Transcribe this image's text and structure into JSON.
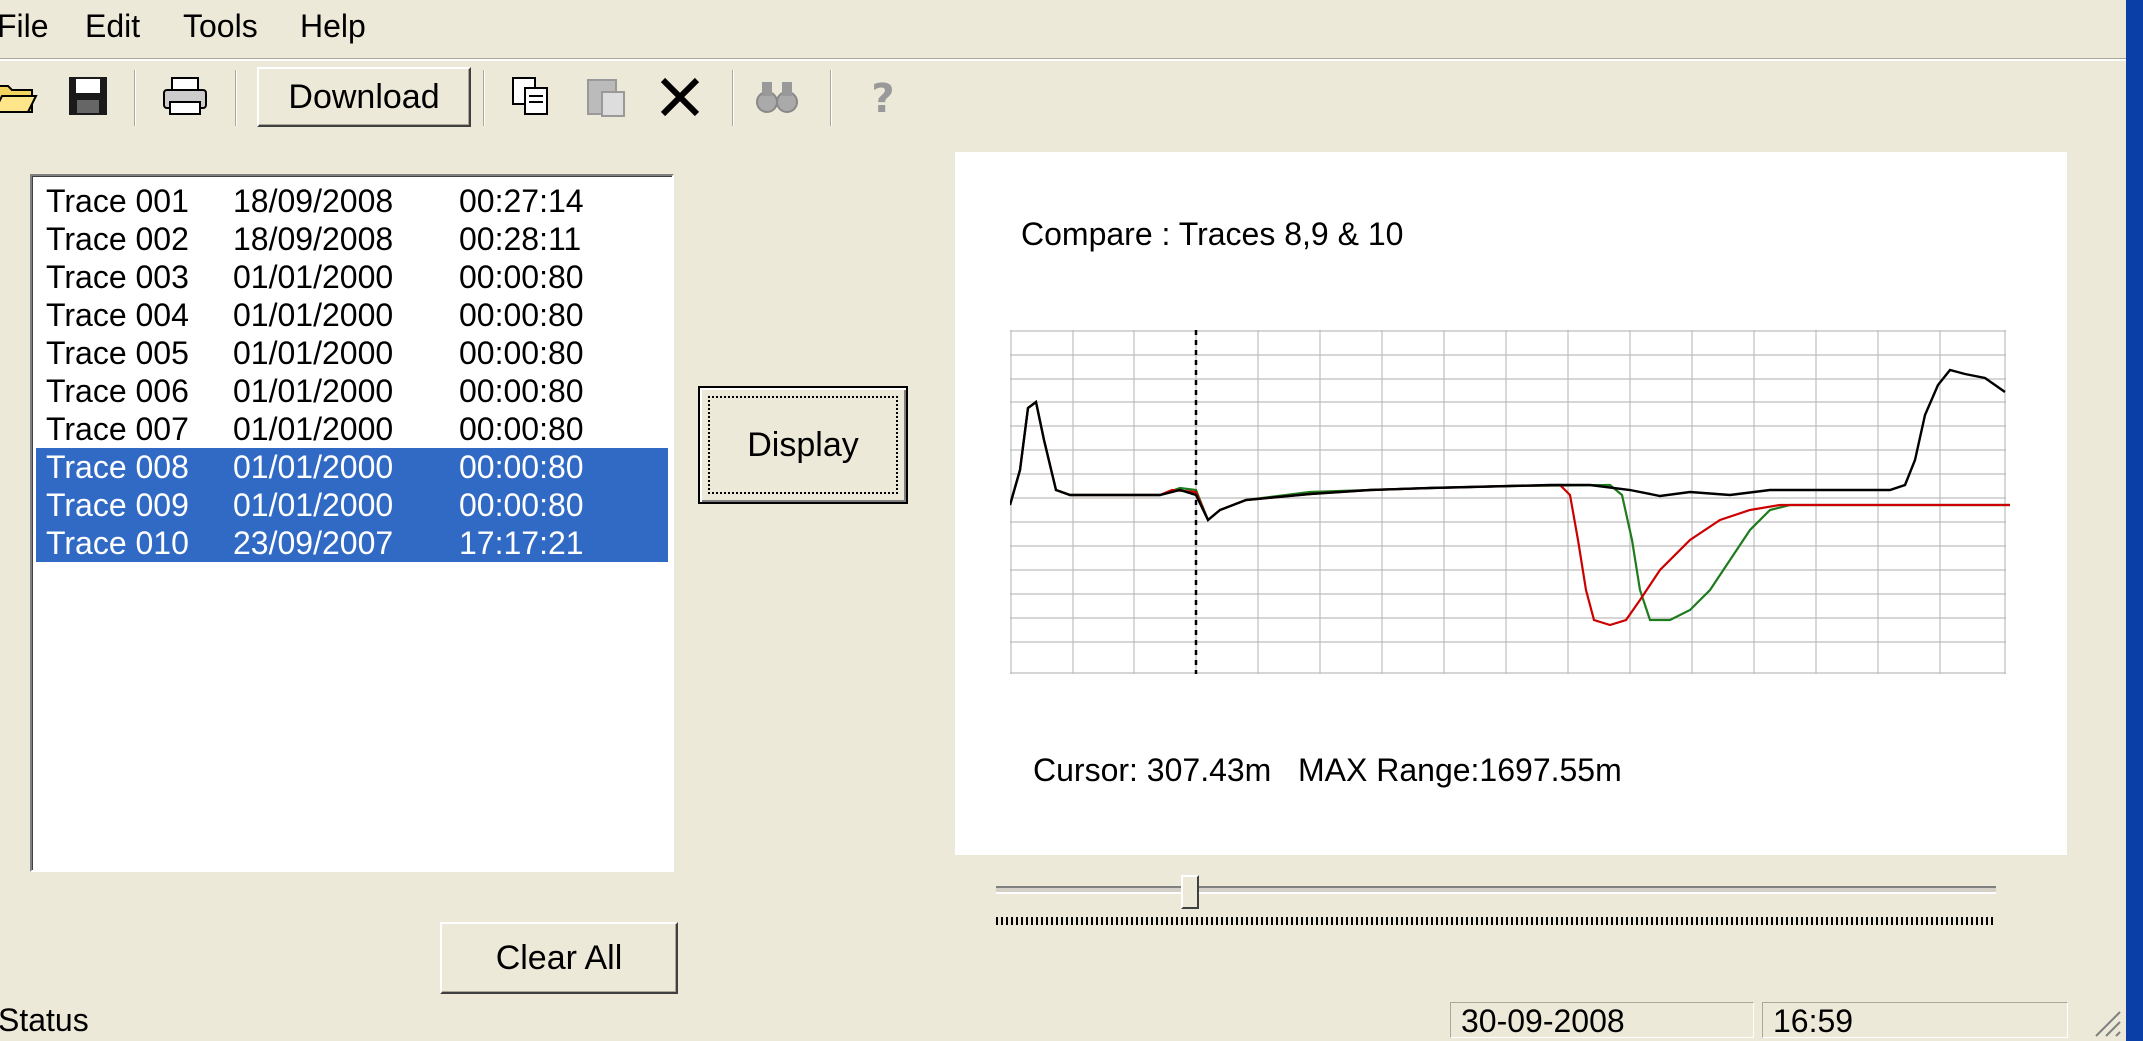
{
  "menu": [
    "File",
    "Edit",
    "Tools",
    "Help"
  ],
  "toolbar": {
    "download_label": "Download"
  },
  "traces": [
    {
      "name": "Trace 001",
      "date": "18/09/2008",
      "time": "00:27:14",
      "selected": false
    },
    {
      "name": "Trace 002",
      "date": "18/09/2008",
      "time": "00:28:11",
      "selected": false
    },
    {
      "name": "Trace 003",
      "date": "01/01/2000",
      "time": "00:00:80",
      "selected": false
    },
    {
      "name": "Trace 004",
      "date": "01/01/2000",
      "time": "00:00:80",
      "selected": false
    },
    {
      "name": "Trace 005",
      "date": "01/01/2000",
      "time": "00:00:80",
      "selected": false
    },
    {
      "name": "Trace 006",
      "date": "01/01/2000",
      "time": "00:00:80",
      "selected": false
    },
    {
      "name": "Trace 007",
      "date": "01/01/2000",
      "time": "00:00:80",
      "selected": false
    },
    {
      "name": "Trace 008",
      "date": "01/01/2000",
      "time": "00:00:80",
      "selected": true
    },
    {
      "name": "Trace 009",
      "date": "01/01/2000",
      "time": "00:00:80",
      "selected": true
    },
    {
      "name": "Trace 010",
      "date": "23/09/2007",
      "time": "17:17:21",
      "selected": true
    }
  ],
  "display_label": "Display",
  "clear_all_label": "Clear All",
  "chart": {
    "title": "Compare : Traces 8,9 & 10",
    "cursor_label": "Cursor: 307.43m",
    "max_range_label": "MAX Range:1697.55m",
    "series_colors": {
      "black": "#000000",
      "red": "#CC0000",
      "green": "#1E7B1E"
    }
  },
  "slider": {
    "position_fraction": 0.19
  },
  "status": {
    "text": "Status",
    "date": "30-09-2008",
    "time": "16:59"
  },
  "colors": {
    "face": "#ECE9D8",
    "selection": "#316AC5",
    "title_edge": "#0B3FA8"
  }
}
